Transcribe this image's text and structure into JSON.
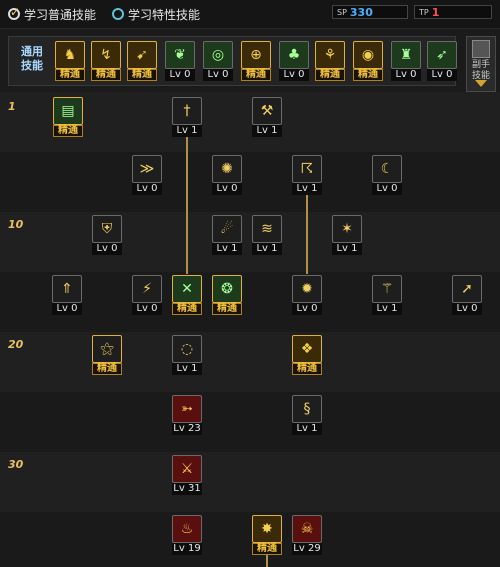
{
  "header": {
    "learn_normal_label": "学习普通技能",
    "learn_special_label": "学习特性技能",
    "sp_tag": "SP",
    "sp_value": "330",
    "tp_tag": "TP",
    "tp_value": "1"
  },
  "quick_bar": {
    "label_line1": "通用",
    "label_line2": "技能",
    "items": [
      {
        "level": "精通",
        "master": true,
        "icon": "sit-icon"
      },
      {
        "level": "精通",
        "master": true,
        "icon": "leap-icon"
      },
      {
        "level": "精通",
        "master": true,
        "icon": "kick-icon"
      },
      {
        "level": "Lv 0",
        "master": false,
        "icon": "wings-icon"
      },
      {
        "level": "Lv 0",
        "master": false,
        "icon": "target-icon"
      },
      {
        "level": "精通",
        "master": true,
        "icon": "crosshair-icon"
      },
      {
        "level": "Lv 0",
        "master": false,
        "icon": "mushroom-icon"
      },
      {
        "level": "精通",
        "master": true,
        "icon": "crouch-icon"
      },
      {
        "level": "精通",
        "master": true,
        "icon": "eye-icon"
      },
      {
        "level": "Lv 0",
        "master": false,
        "icon": "figure-icon"
      },
      {
        "level": "Lv 0",
        "master": false,
        "icon": "walk-icon"
      }
    ]
  },
  "skill_button": {
    "line1": "副手",
    "line2": "技能"
  },
  "level_markers": [
    "1",
    "10",
    "20",
    "30"
  ],
  "skills": [
    {
      "level": "精通",
      "master": true,
      "icon": "book-icon",
      "color": "green"
    },
    {
      "level": "Lv 1",
      "master": false,
      "icon": "dagger-icon",
      "color": "dark"
    },
    {
      "level": "Lv 1",
      "master": false,
      "icon": "hammer-icon",
      "color": "dark"
    },
    {
      "level": "Lv 0",
      "master": false,
      "icon": "dash-icon",
      "color": "dark"
    },
    {
      "level": "Lv 0",
      "master": false,
      "icon": "fireball-icon",
      "color": "dark"
    },
    {
      "level": "Lv 1",
      "master": false,
      "icon": "spin-icon",
      "color": "dark"
    },
    {
      "level": "Lv 0",
      "master": false,
      "icon": "crescent-icon",
      "color": "dark"
    },
    {
      "level": "Lv 0",
      "master": false,
      "icon": "shield-icon",
      "color": "dark"
    },
    {
      "level": "Lv 1",
      "master": false,
      "icon": "runner-icon",
      "color": "dark"
    },
    {
      "level": "Lv 1",
      "master": false,
      "icon": "slash-icon",
      "color": "dark"
    },
    {
      "level": "Lv 1",
      "master": false,
      "icon": "burst-icon",
      "color": "dark"
    },
    {
      "level": "Lv 0",
      "master": false,
      "icon": "uppercut-icon",
      "color": "dark"
    },
    {
      "level": "Lv 0",
      "master": false,
      "icon": "strike-icon",
      "color": "dark"
    },
    {
      "level": "精通",
      "master": true,
      "icon": "cross-blades-icon",
      "color": "green"
    },
    {
      "level": "精通",
      "master": true,
      "icon": "rune-icon",
      "color": "green"
    },
    {
      "level": "Lv 0",
      "master": false,
      "icon": "impact-icon",
      "color": "dark"
    },
    {
      "level": "Lv 1",
      "master": false,
      "icon": "staff-icon",
      "color": "dark"
    },
    {
      "level": "Lv 0",
      "master": false,
      "icon": "spear-icon",
      "color": "dark"
    },
    {
      "level": "精通",
      "master": true,
      "icon": "claw-icon",
      "color": "dark"
    },
    {
      "level": "Lv 1",
      "master": false,
      "icon": "vortex-icon",
      "color": "dark"
    },
    {
      "level": "精通",
      "master": true,
      "icon": "coins-icon",
      "color": "gold"
    },
    {
      "level": "Lv 23",
      "master": false,
      "icon": "feather-spear-icon",
      "color": "red"
    },
    {
      "level": "Lv 1",
      "master": false,
      "icon": "tornado-icon",
      "color": "dark"
    },
    {
      "level": "Lv 31",
      "master": false,
      "icon": "blade-icon",
      "color": "red"
    },
    {
      "level": "Lv 19",
      "master": false,
      "icon": "flame-icon",
      "color": "red"
    },
    {
      "level": "精通",
      "master": true,
      "icon": "explosion-icon",
      "color": "gold"
    },
    {
      "level": "Lv 29",
      "master": false,
      "icon": "demon-icon",
      "color": "red"
    }
  ]
}
